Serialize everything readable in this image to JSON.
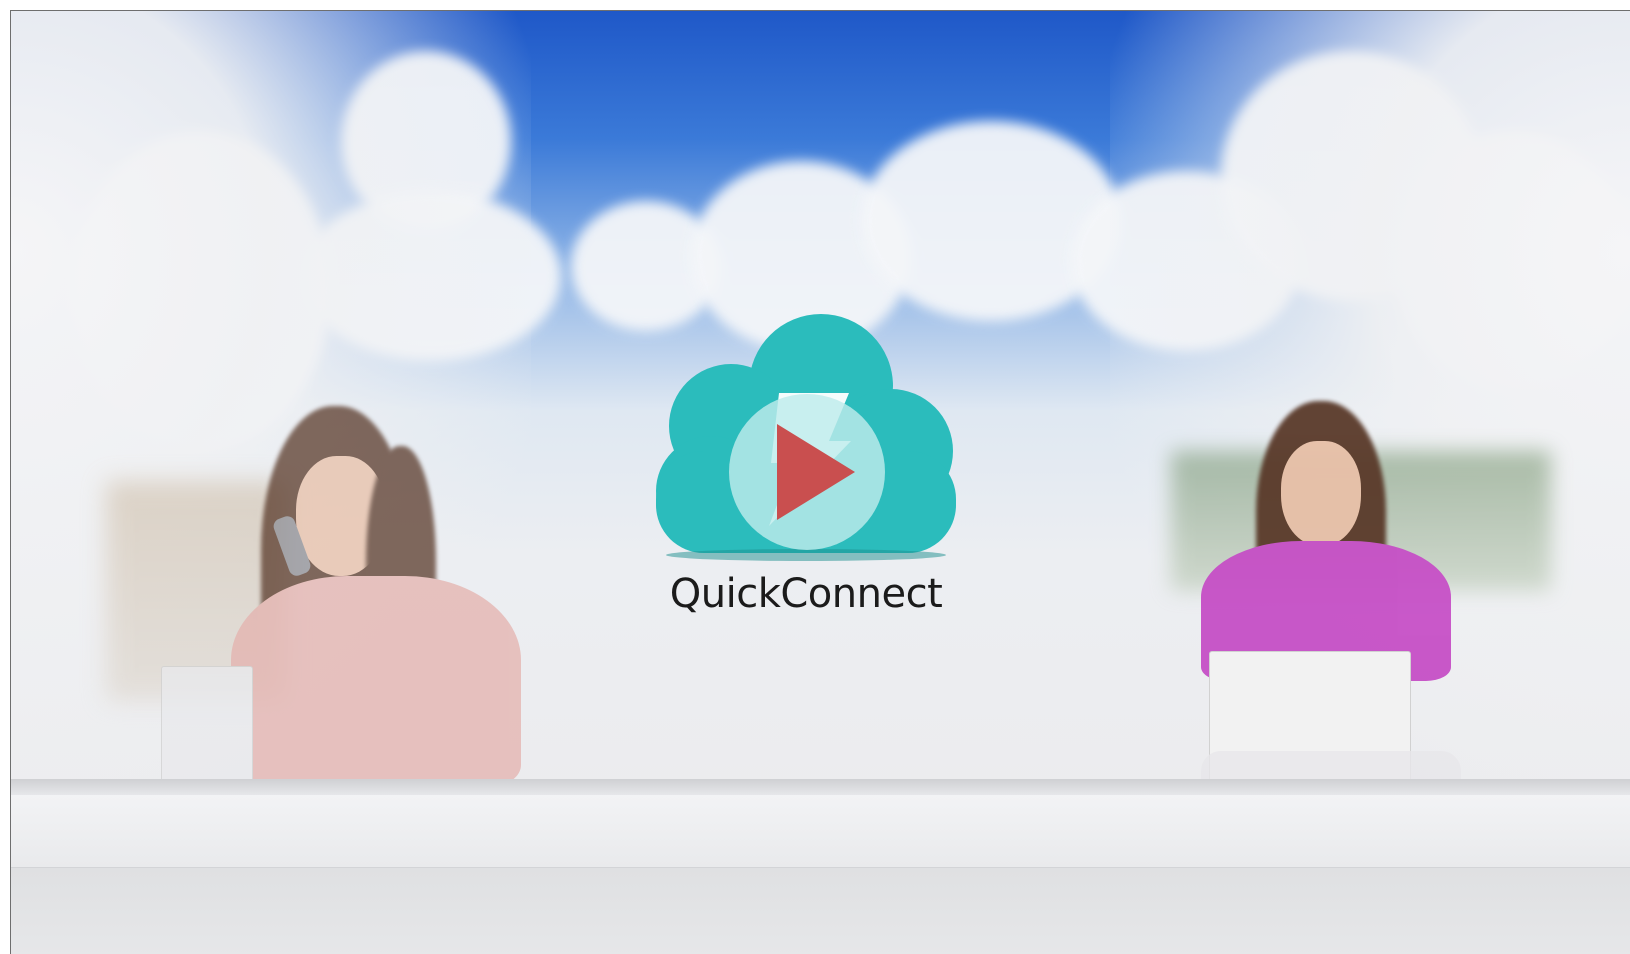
{
  "app": {
    "brand_name": "QuickConnect"
  },
  "video": {
    "play_icon": "play-icon",
    "logo_icon": "cloud-lightning-icon"
  },
  "colors": {
    "logo_teal": "#2bbcbc",
    "play_button_bg": "#bfecec",
    "play_triangle": "#c94f4f",
    "sky_blue": "#1f58c8"
  }
}
